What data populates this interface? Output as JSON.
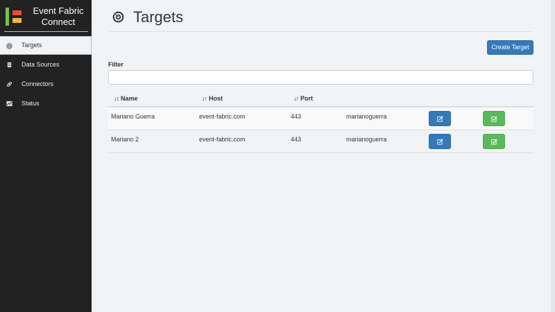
{
  "brand": {
    "title_line1": "Event Fabric",
    "title_line2": "Connect"
  },
  "colors": {
    "logo_green": "#78c24a",
    "logo_red": "#e84c3d",
    "logo_yellow": "#f2b632",
    "primary": "#337ab7",
    "success": "#5cb85c",
    "sidebar_bg": "#222222"
  },
  "nav": {
    "items": [
      {
        "label": "Targets",
        "icon": "target-icon",
        "active": true
      },
      {
        "label": "Data Sources",
        "icon": "database-icon",
        "active": false
      },
      {
        "label": "Connectors",
        "icon": "link-icon",
        "active": false
      },
      {
        "label": "Status",
        "icon": "chart-icon",
        "active": false
      }
    ]
  },
  "page": {
    "title": "Targets",
    "icon": "target-icon"
  },
  "toolbar": {
    "create_label": "Create Target"
  },
  "filter": {
    "label": "Filter",
    "value": "",
    "placeholder": ""
  },
  "table": {
    "columns": [
      {
        "label": "Name",
        "sort_icon": "sort-alpha-icon"
      },
      {
        "label": "Host",
        "sort_icon": "sort-icon"
      },
      {
        "label": "Port",
        "sort_icon": "sort-icon"
      }
    ],
    "rows": [
      {
        "name": "Mariano Guerra",
        "host": "event-fabric.com",
        "port": "443",
        "user": "marianoguerra"
      },
      {
        "name": "Mariano 2",
        "host": "event-fabric.com",
        "port": "443",
        "user": "marianoguerra"
      }
    ]
  }
}
